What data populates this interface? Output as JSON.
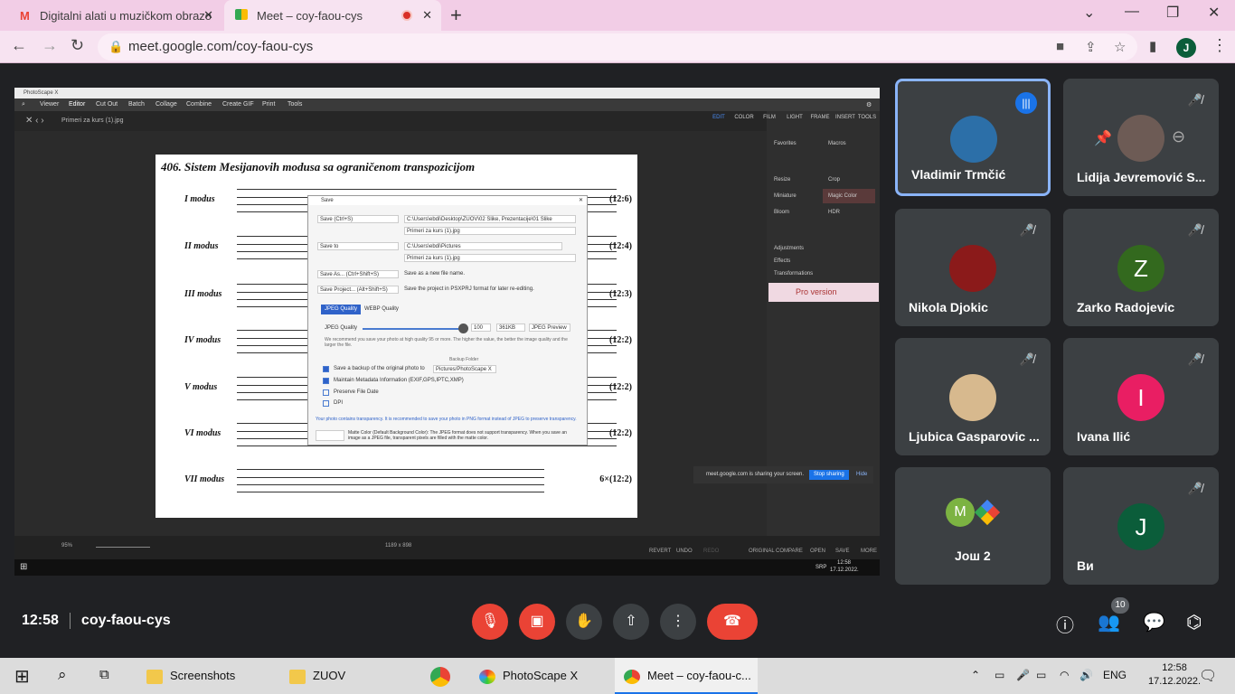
{
  "browser": {
    "tabs": [
      {
        "title": "Digitalni alati u muzičkom obrazo",
        "favicon": "M",
        "favicon_color": "#ea4335"
      },
      {
        "title": "Meet – coy-faou-cys",
        "favicon": "meet-icon",
        "recording": true
      }
    ],
    "url": "meet.google.com/coy-faou-cys",
    "profile_initial": "J"
  },
  "photoscape": {
    "app_title": "PhotoScape X",
    "menu": [
      "Viewer",
      "Editor",
      "Cut Out",
      "Batch",
      "Collage",
      "Combine",
      "Create GIF",
      "Print",
      "Tools"
    ],
    "file_name": "Primeri za kurs (1).jpg",
    "sheet_title": "406. Sistem Mesijanovih modusa sa ograničenom transpozicijom",
    "modes": [
      {
        "label": "I modus",
        "ratio": "(12:6)"
      },
      {
        "label": "II modus",
        "ratio": "(12:4)"
      },
      {
        "label": "III modus",
        "ratio": "(12:3)"
      },
      {
        "label": "IV modus",
        "ratio": "(12:2)"
      },
      {
        "label": "V modus",
        "ratio": "(12:2)"
      },
      {
        "label": "VI modus",
        "ratio": "(12:2)"
      },
      {
        "label": "VII modus",
        "ratio": "6×(12:2)"
      }
    ],
    "right_tools": [
      "EDIT",
      "COLOR",
      "FILM",
      "LIGHT",
      "FRAME",
      "INSERT",
      "TOOLS"
    ],
    "right_rows": [
      "Favorites",
      "Macros",
      "Resize",
      "Crop",
      "Miniature",
      "Magic Color",
      "Bloom",
      "HDR",
      "Adjustments",
      "Effects",
      "Transformations"
    ],
    "promo": "Pro version",
    "save_dialog": {
      "title": "Save",
      "save_label": "Save (Ctrl+S)",
      "save_path": "C:\\Users\\ebdi\\Desktop\\ZUOV\\02 Slike, Prezentacije\\01 Slike",
      "save_file": "Primeri za kurs (1).jpg",
      "save_to_label": "Save to",
      "save_to_path": "C:\\Users\\ebdi\\Pictures",
      "save_to_file": "Primeri za kurs (1).jpg",
      "save_as_label": "Save As... (Ctrl+Shift+S)",
      "save_as_desc": "Save as a new file name.",
      "save_project_label": "Save Project... (Alt+Shift+S)",
      "save_project_desc": "Save the project in PSXPRJ format for later re-editing.",
      "tab_jpeg": "JPEG Quality",
      "tab_webp": "WEBP Quality",
      "quality_label": "JPEG Quality",
      "quality_value": "100",
      "quality_fraction": 0.95,
      "size": "361KB",
      "preview": "JPEG Preview",
      "recommend": "We recommend you save your photo at high quality 95 or more. The higher the value, the better the image quality and the larger the file.",
      "backup_folder_label": "Backup Folder",
      "opt_backup": "Save a backup of the original photo to",
      "backup_path": "Pictures/PhotoScape X",
      "opt_metadata": "Maintain Metadata Information (EXIF,GPS,IPTC,XMP)",
      "opt_date": "Preserve File Date",
      "opt_dpi": "DPI",
      "transparency_note": "Your photo contains transparency. It is recommended to save your photo in PNG format instead of JPEG to preserve transparency.",
      "matte_note": "Matte Color (Default Background Color): The JPEG format does not support transparency. When you save an image as a JPEG file, transparent pixels are filled with the matte color."
    },
    "share_bar": {
      "text": "meet.google.com is sharing your screen.",
      "stop": "Stop sharing",
      "hide": "Hide"
    },
    "zoom": "95%",
    "dimensions": "1189 x 898",
    "bottom_tools": [
      "REVERT",
      "UNDO",
      "REDO",
      "ORIGINAL",
      "COMPARE",
      "OPEN",
      "SAVE",
      "MORE"
    ],
    "inner_clock_time": "12:58",
    "inner_clock_date": "17.12.2022.",
    "inner_lang": "SRP"
  },
  "participants": [
    {
      "name": "Vladimir Trmčić",
      "speaking": true,
      "avatar_color": "#2c6fa8",
      "initial": ""
    },
    {
      "name": "Lidija Jevremović S...",
      "muted": true,
      "avatar_color": "#8d6e63",
      "initial": ""
    },
    {
      "name": "Nikola Djokic",
      "muted": true,
      "avatar_color": "#8b1a1a",
      "initial": ""
    },
    {
      "name": "Zarko Radojevic",
      "muted": true,
      "avatar_color": "#33691e",
      "initial": "Z"
    },
    {
      "name": "Ljubica Gasparovic ...",
      "muted": true,
      "avatar_color": "#d7b98e",
      "initial": ""
    },
    {
      "name": "Ivana Ilić",
      "muted": true,
      "avatar_color": "#e91e63",
      "initial": "I"
    },
    {
      "name": "Још 2",
      "muted": false,
      "avatar_color": "#7cb342",
      "initial": "M"
    },
    {
      "name": "Ви",
      "muted": true,
      "avatar_color": "#0b5d3a",
      "initial": "J"
    }
  ],
  "meeting": {
    "time": "12:58",
    "code": "coy-faou-cys",
    "participant_count": "10"
  },
  "taskbar": {
    "items": [
      "Screenshots",
      "ZUOV",
      "PhotoScape X",
      "Meet – coy-faou-c..."
    ],
    "lang": "ENG",
    "time": "12:58",
    "date": "17.12.2022."
  }
}
